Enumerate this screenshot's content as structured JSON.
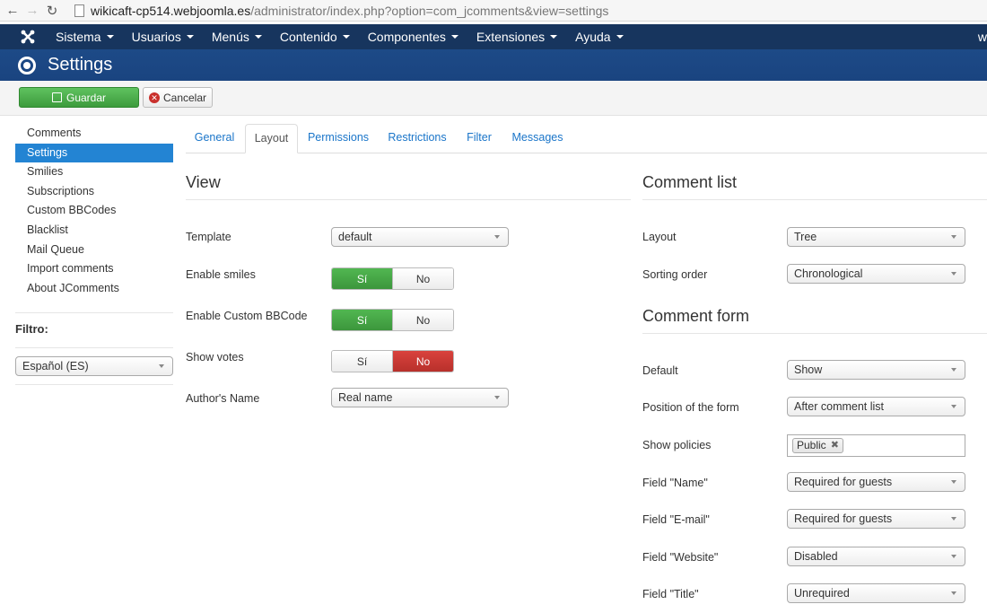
{
  "browser": {
    "url_host": "wikicaft-cp514.webjoomla.es",
    "url_path": "/administrator/index.php?option=com_jcomments&view=settings"
  },
  "topmenu": {
    "items": [
      {
        "label": "Sistema"
      },
      {
        "label": "Usuarios"
      },
      {
        "label": "Menús"
      },
      {
        "label": "Contenido"
      },
      {
        "label": "Componentes"
      },
      {
        "label": "Extensiones"
      },
      {
        "label": "Ayuda"
      }
    ],
    "user_initial": "w"
  },
  "header": {
    "title": "Settings"
  },
  "toolbar": {
    "save_label": "Guardar",
    "cancel_label": "Cancelar"
  },
  "sidebar": {
    "items": [
      {
        "label": "Comments"
      },
      {
        "label": "Settings"
      },
      {
        "label": "Smilies"
      },
      {
        "label": "Subscriptions"
      },
      {
        "label": "Custom BBCodes"
      },
      {
        "label": "Blacklist"
      },
      {
        "label": "Mail Queue"
      },
      {
        "label": "Import comments"
      },
      {
        "label": "About JComments"
      }
    ],
    "active_index": 1,
    "filter_label": "Filtro:",
    "filter_value": "Español (ES)"
  },
  "tabs": [
    {
      "label": "General"
    },
    {
      "label": "Layout"
    },
    {
      "label": "Permissions"
    },
    {
      "label": "Restrictions"
    },
    {
      "label": "Filter"
    },
    {
      "label": "Messages"
    }
  ],
  "view": {
    "heading": "View",
    "template_label": "Template",
    "template_value": "default",
    "smiles_label": "Enable smiles",
    "bbcode_label": "Enable Custom BBCode",
    "votes_label": "Show votes",
    "author_label": "Author's Name",
    "author_value": "Real name",
    "yes": "Sí",
    "no": "No"
  },
  "comment_list": {
    "heading": "Comment list",
    "layout_label": "Layout",
    "layout_value": "Tree",
    "sort_label": "Sorting order",
    "sort_value": "Chronological"
  },
  "comment_form": {
    "heading": "Comment form",
    "default_label": "Default",
    "default_value": "Show",
    "position_label": "Position of the form",
    "position_value": "After comment list",
    "policies_label": "Show policies",
    "policies_tag": "Public",
    "name_label": "Field \"Name\"",
    "name_value": "Required for guests",
    "email_label": "Field \"E-mail\"",
    "email_value": "Required for guests",
    "website_label": "Field \"Website\"",
    "website_value": "Disabled",
    "title_label": "Field \"Title\"",
    "title_value": "Unrequired"
  },
  "colors": {
    "menu_bg": "#17355e",
    "title_bg": "#1d4a87",
    "accent": "#2384d3",
    "success": "#46a546",
    "danger": "#c9302c"
  }
}
